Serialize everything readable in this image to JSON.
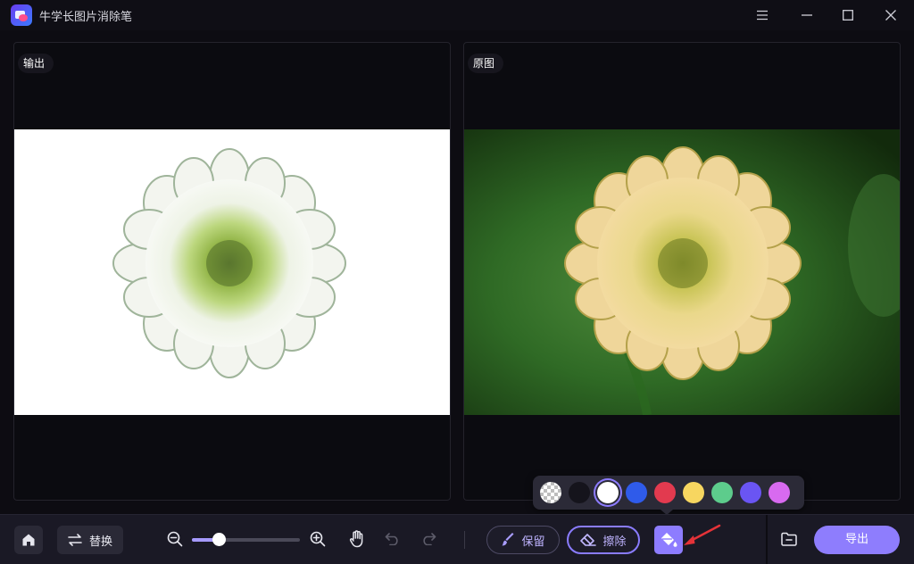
{
  "app": {
    "title": "牛学长图片消除笔"
  },
  "window_controls": [
    "menu-icon",
    "minimize-icon",
    "maximize-icon",
    "close-icon"
  ],
  "panels": {
    "output": {
      "label": "输出",
      "background": "#ffffff"
    },
    "original": {
      "label": "原图"
    }
  },
  "toolbar": {
    "home_icon": "home-icon",
    "replace_label": "替换",
    "zoom_level": 0.25,
    "keep_label": "保留",
    "erase_label": "擦除",
    "export_label": "导出"
  },
  "color_palette": {
    "selected": "#ffffff",
    "swatches": [
      "transparent",
      "#15141c",
      "#ffffff",
      "#2f5bea",
      "#e23a4f",
      "#f7d660",
      "#5dcc8c",
      "#6a55f3",
      "#d86af0"
    ]
  },
  "colors": {
    "accent": "#8e7dfd",
    "background": "#0d0c12",
    "toolbar": "#1a1925"
  }
}
